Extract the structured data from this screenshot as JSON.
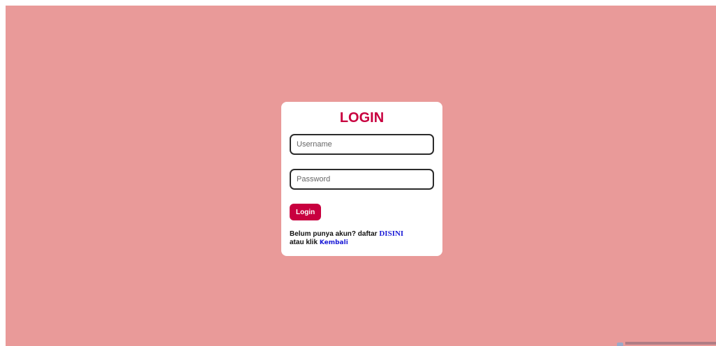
{
  "login": {
    "title": "LOGIN",
    "username_placeholder": "Username",
    "password_placeholder": "Password",
    "button_label": "Login",
    "signup_prefix": "Belum punya akun? daftar ",
    "signup_link": "DISINI",
    "back_prefix": "atau klik ",
    "back_link": "Kembali"
  },
  "colors": {
    "background": "#e99a99",
    "card": "#ffffff",
    "accent": "#c8003f",
    "link": "#1a1ad6"
  }
}
